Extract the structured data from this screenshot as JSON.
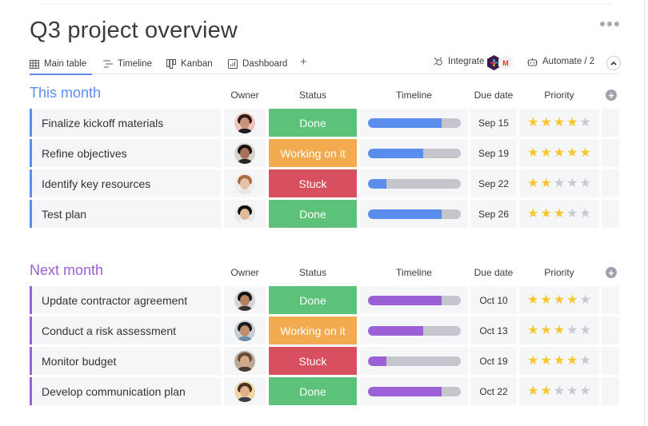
{
  "page": {
    "title": "Q3 project overview"
  },
  "tabs": [
    {
      "label": "Main table",
      "icon": "table-icon",
      "active": true
    },
    {
      "label": "Timeline",
      "icon": "timeline-icon",
      "active": false
    },
    {
      "label": "Kanban",
      "icon": "kanban-icon",
      "active": false
    },
    {
      "label": "Dashboard",
      "icon": "dashboard-icon",
      "active": false
    }
  ],
  "tab_add_label": "+",
  "toolbar": {
    "integrate_label": "Integrate",
    "automate_label": "Automate / 2",
    "gmail_letter": "M"
  },
  "columns": {
    "owner": "Owner",
    "status": "Status",
    "timeline": "Timeline",
    "due": "Due date",
    "priority": "Priority"
  },
  "colors": {
    "done": "#5cc27a",
    "working": "#f2ab4e",
    "stuck": "#d84f5f",
    "star_on": "#f8c630",
    "star_off": "#c8c9d1",
    "this_month": "#5b8def",
    "next_month": "#9b5fd6"
  },
  "groups": [
    {
      "title": "This month",
      "color": "#5b8def",
      "rows": [
        {
          "name": "Finalize kickoff materials",
          "status": "Done",
          "status_key": "done",
          "timeline_progress": 0.8,
          "due": "Sep 15",
          "priority": 4,
          "avatar": {
            "skin": "#c89478",
            "hair": "#2a1a14",
            "bg": "#f2c4bd",
            "shirt": "#1e1e22"
          }
        },
        {
          "name": "Refine objectives",
          "status": "Working on it",
          "status_key": "working",
          "timeline_progress": 0.6,
          "due": "Sep 19",
          "priority": 5,
          "avatar": {
            "skin": "#a7725a",
            "hair": "#16110f",
            "bg": "#d9d2cc",
            "shirt": "#2b2524"
          }
        },
        {
          "name": "Identify key resources",
          "status": "Stuck",
          "status_key": "stuck",
          "timeline_progress": 0.2,
          "due": "Sep 22",
          "priority": 2,
          "avatar": {
            "skin": "#e6c3a8",
            "hair": "#a86b43",
            "bg": "#f1efee",
            "shirt": "#e9e6e4"
          }
        },
        {
          "name": "Test plan",
          "status": "Done",
          "status_key": "done",
          "timeline_progress": 0.8,
          "due": "Sep 26",
          "priority": 3,
          "avatar": {
            "skin": "#e0b996",
            "hair": "#111111",
            "bg": "#e9e9ec",
            "shirt": "#f4f4f6"
          }
        }
      ]
    },
    {
      "title": "Next month",
      "color": "#9b5fd6",
      "rows": [
        {
          "name": "Update contractor agreement",
          "status": "Done",
          "status_key": "done",
          "timeline_progress": 0.8,
          "due": "Oct 10",
          "priority": 4,
          "avatar": {
            "skin": "#b47f63",
            "hair": "#17110e",
            "bg": "#d5d4d6",
            "shirt": "#3a3230"
          }
        },
        {
          "name": "Conduct a risk assessment",
          "status": "Working on it",
          "status_key": "working",
          "timeline_progress": 0.6,
          "due": "Oct 13",
          "priority": 3,
          "avatar": {
            "skin": "#c08e6d",
            "hair": "#1a1a1c",
            "bg": "#c9ccd2",
            "shirt": "#6f8bab"
          }
        },
        {
          "name": "Monitor budget",
          "status": "Stuck",
          "status_key": "stuck",
          "timeline_progress": 0.2,
          "due": "Oct 19",
          "priority": 4,
          "avatar": {
            "skin": "#d6a888",
            "hair": "#6b4a34",
            "bg": "#b8aa9c",
            "shirt": "#4a3b32"
          }
        },
        {
          "name": "Develop communication plan",
          "status": "Done",
          "status_key": "done",
          "timeline_progress": 0.8,
          "due": "Oct 22",
          "priority": 2,
          "avatar": {
            "skin": "#e0b08a",
            "hair": "#4a3224",
            "bg": "#efd6a8",
            "shirt": "#3a3d4a"
          }
        }
      ]
    }
  ],
  "priority_max": 5
}
